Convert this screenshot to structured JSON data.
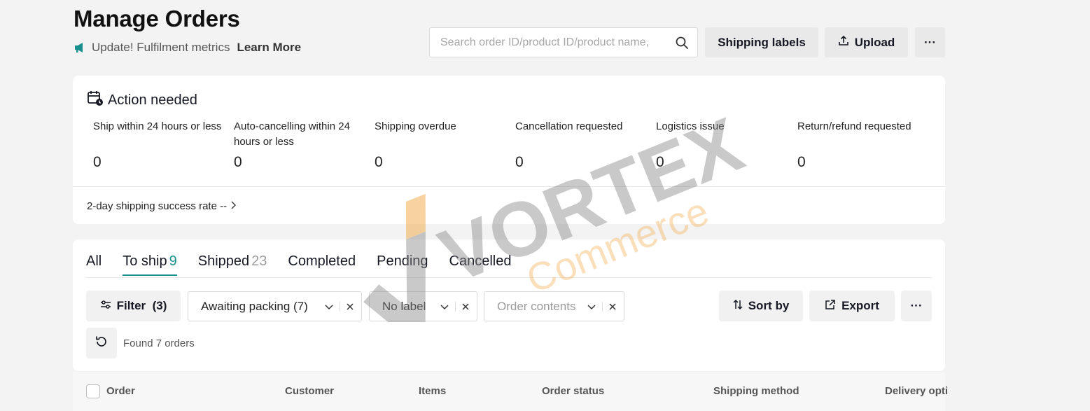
{
  "header": {
    "title": "Manage Orders",
    "update_text": "Update! Fulfilment metrics",
    "learn_more": "Learn More",
    "search_placeholder": "Search order ID/product ID/product name,",
    "shipping_labels": "Shipping labels",
    "upload": "Upload",
    "more": "···"
  },
  "action_needed": {
    "title": "Action needed",
    "metrics": [
      {
        "label": "Ship within 24 hours or less",
        "value": "0"
      },
      {
        "label": "Auto-cancelling within 24 hours or less",
        "value": "0"
      },
      {
        "label": "Shipping overdue",
        "value": "0"
      },
      {
        "label": "Cancellation requested",
        "value": "0"
      },
      {
        "label": "Logistics issue",
        "value": "0"
      },
      {
        "label": "Return/refund requested",
        "value": "0"
      }
    ],
    "success_rate": "2-day shipping success rate --"
  },
  "tabs": [
    {
      "label": "All",
      "count": ""
    },
    {
      "label": "To ship",
      "count": "9"
    },
    {
      "label": "Shipped",
      "count": "23"
    },
    {
      "label": "Completed",
      "count": ""
    },
    {
      "label": "Pending",
      "count": ""
    },
    {
      "label": "Cancelled",
      "count": ""
    }
  ],
  "filters": {
    "filter_button": "Filter  (3)",
    "chips": [
      {
        "text": "Awaiting packing (7)",
        "placeholder": false
      },
      {
        "text": "No label",
        "placeholder": false
      },
      {
        "text": "Order contents",
        "placeholder": true
      }
    ],
    "sort_by": "Sort by",
    "export": "Export",
    "more": "···",
    "found_text": "Found 7 orders"
  },
  "table": {
    "columns": [
      "Order",
      "Customer",
      "Items",
      "Order status",
      "Shipping method",
      "Delivery opti"
    ]
  },
  "watermark": {
    "brand": "VORTEX",
    "sub": "Commerce"
  },
  "colors": {
    "accent": "#1a8f8f",
    "background": "#f3f3f3",
    "button_bg": "#e9e9e9"
  }
}
